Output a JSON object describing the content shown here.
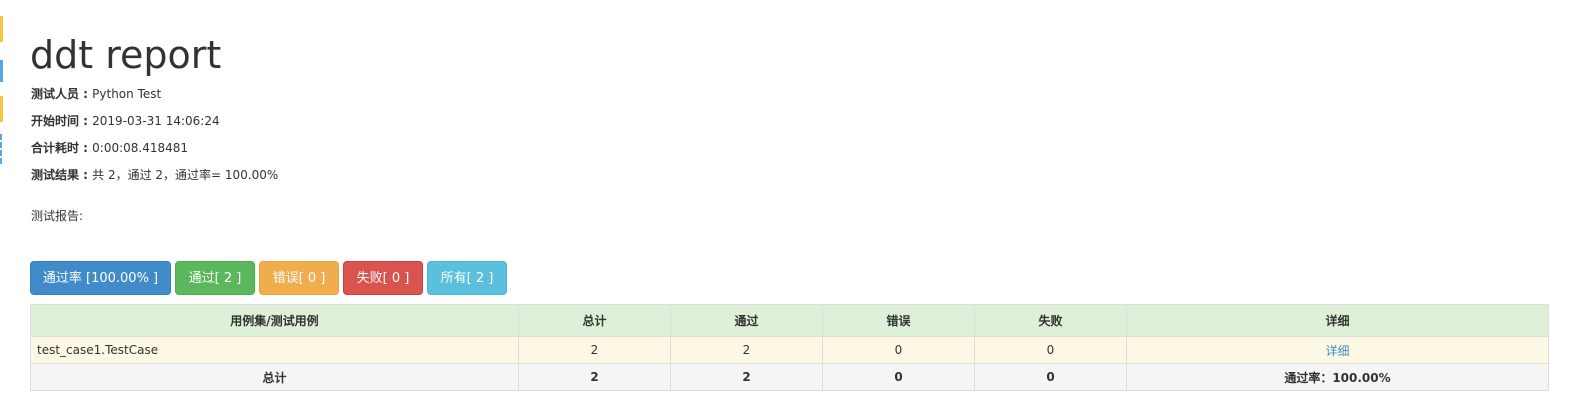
{
  "header": {
    "title": "ddt report"
  },
  "info": {
    "tester_label": "测试人员 : ",
    "tester_value": "Python Test",
    "start_label": "开始时间 : ",
    "start_value": "2019-03-31 14:06:24",
    "duration_label": "合计耗时 : ",
    "duration_value": "0:00:08.418481",
    "result_label": "测试结果 : ",
    "result_value": "共 2，通过 2，通过率= 100.00%"
  },
  "report_label": "测试报告:",
  "filters": {
    "pass_rate": "通过率 [100.00% ]",
    "passed": "通过[ 2 ]",
    "errors": "错误[ 0 ]",
    "failures": "失败[ 0 ]",
    "all": "所有[ 2 ]"
  },
  "table": {
    "headers": {
      "suite": "用例集/测试用例",
      "total": "总计",
      "pass": "通过",
      "error": "错误",
      "fail": "失败",
      "detail": "详细"
    },
    "rows": [
      {
        "name": "test_case1.TestCase",
        "total": "2",
        "pass": "2",
        "error": "0",
        "fail": "0",
        "detail": "详细"
      }
    ],
    "summary": {
      "label": "总计",
      "total": "2",
      "pass": "2",
      "error": "0",
      "fail": "0",
      "rate": "通过率：100.00%"
    }
  },
  "colors": {
    "primary": "#428bca",
    "success": "#5cb85c",
    "warning": "#f0ad4e",
    "danger": "#d9534f",
    "info": "#5bc0de",
    "header_row": "#dff0d8",
    "case_row": "#fcf8e3"
  }
}
